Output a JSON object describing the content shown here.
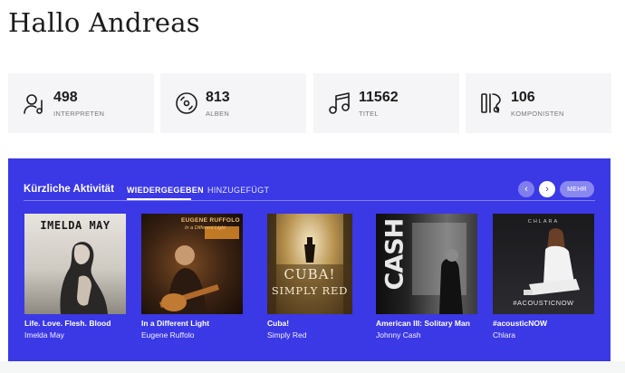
{
  "greeting": "Hallo Andreas",
  "stats": [
    {
      "value": "498",
      "label": "INTERPRETEN",
      "icon": "artist-icon"
    },
    {
      "value": "813",
      "label": "ALBEN",
      "icon": "disc-icon"
    },
    {
      "value": "11562",
      "label": "TITEL",
      "icon": "music-note-icon"
    },
    {
      "value": "106",
      "label": "KOMPONISTEN",
      "icon": "composer-icon"
    }
  ],
  "activity": {
    "title": "Kürzliche Aktivität",
    "tabs": [
      {
        "label": "WIEDERGEGEBEN",
        "active": true
      },
      {
        "label": "HINZUGEFÜGT",
        "active": false
      }
    ],
    "prev_symbol": "‹",
    "next_symbol": "›",
    "more_label": "MEHR",
    "accent_color": "#3b38e6",
    "albums": [
      {
        "title": "Life. Love. Flesh. Blood",
        "artist": "Imelda May",
        "cover_text": "IMELDA MAY"
      },
      {
        "title": "In a Different Light",
        "artist": "Eugene Ruffolo",
        "cover_text": "EUGENE RUFFOLO",
        "cover_subtext": "In a Different Light"
      },
      {
        "title": "Cuba!",
        "artist": "Simply Red",
        "cover_text": "CUBA!",
        "cover_subtext": "SIMPLY RED"
      },
      {
        "title": "American III: Solitary Man",
        "artist": "Johnny Cash",
        "cover_text": "CASH"
      },
      {
        "title": "#acousticNOW",
        "artist": "Chlara",
        "cover_text": "CHLARA",
        "cover_subtext": "#ACOUSTICNOW"
      }
    ]
  }
}
